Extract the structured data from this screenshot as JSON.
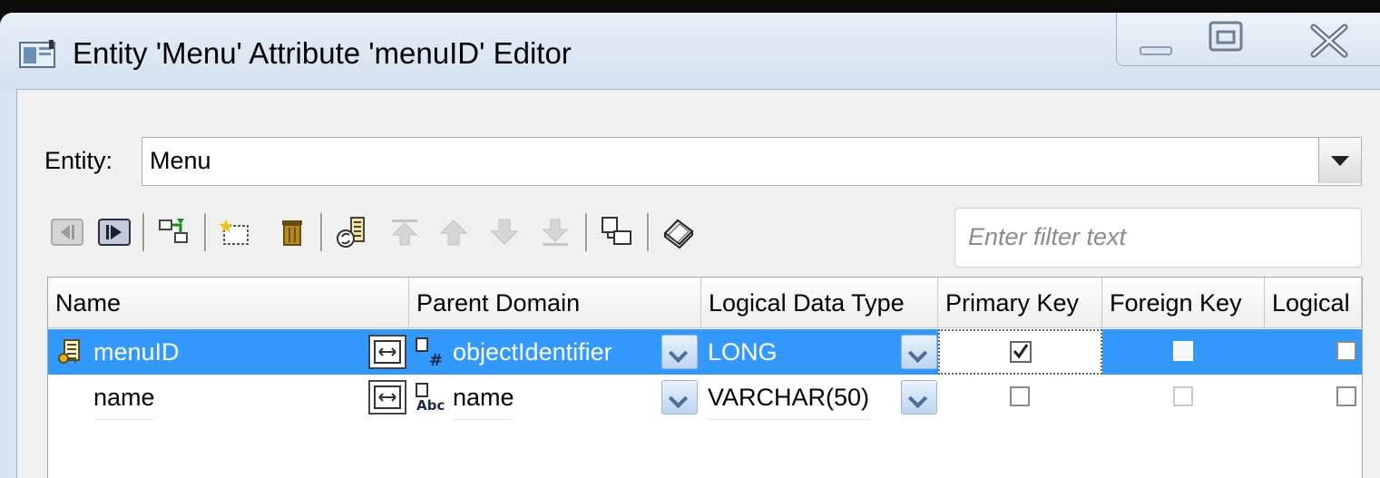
{
  "window": {
    "title": "Entity 'Menu' Attribute 'menuID' Editor"
  },
  "entity": {
    "label": "Entity:",
    "value": "Menu"
  },
  "toolbar": {
    "icons": [
      "first-icon",
      "last-icon",
      "add-child-icon",
      "new-attribute-icon",
      "delete-icon",
      "reorder-icon",
      "move-top-icon",
      "move-up-icon",
      "move-down-icon",
      "move-bottom-icon",
      "copy-icon",
      "properties-icon"
    ]
  },
  "filter": {
    "placeholder": "Enter filter text",
    "value": ""
  },
  "grid": {
    "columns": [
      "Name",
      "Parent Domain",
      "Logical Data Type",
      "Primary Key",
      "Foreign Key",
      "Logical"
    ],
    "rows": [
      {
        "name": "menuID",
        "parent_domain": "objectIdentifier",
        "logical_data_type": "LONG",
        "primary_key": true,
        "foreign_key": false,
        "logical": false,
        "selected": true
      },
      {
        "name": "name",
        "parent_domain": "name",
        "logical_data_type": "VARCHAR(50)",
        "primary_key": false,
        "foreign_key": false,
        "logical": false,
        "selected": false
      }
    ]
  },
  "colors": {
    "selection": "#3399ff",
    "title_bar": "#d6e3f1"
  }
}
